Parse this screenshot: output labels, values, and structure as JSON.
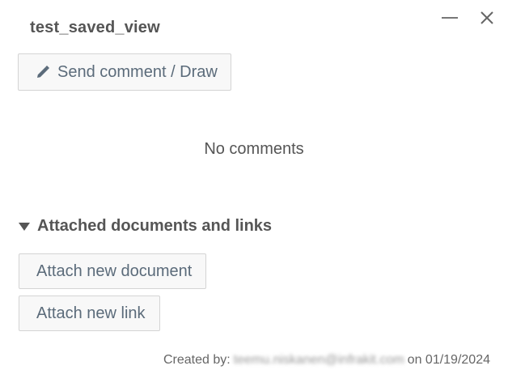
{
  "dialog": {
    "title": "test_saved_view"
  },
  "actions": {
    "send_comment_label": "Send comment / Draw"
  },
  "comments": {
    "empty_text": "No comments"
  },
  "attachments": {
    "section_title": "Attached documents and links",
    "attach_document_label": "Attach new document",
    "attach_link_label": "Attach new link"
  },
  "footer": {
    "created_by_prefix": "Created by:",
    "created_by_email": "teemu.niskanen@infrakit.com",
    "created_on": "on 01/19/2024"
  },
  "icons": {
    "minimize": "minimize-icon",
    "close": "close-icon",
    "pencil": "pencil-icon",
    "caret": "caret-down-icon"
  },
  "colors": {
    "text": "#555555",
    "button_text": "#5b6b7a",
    "button_bg": "#f8f8f8",
    "button_border": "#d4d4d4"
  }
}
